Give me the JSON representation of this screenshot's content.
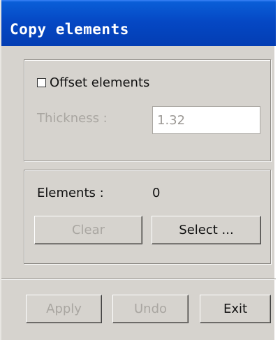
{
  "window": {
    "title": "Copy elements"
  },
  "offset_group": {
    "checkbox_label": "Offset elements",
    "checkbox_checked": false,
    "thickness_label": "Thickness :",
    "thickness_value": "1.32"
  },
  "elements_group": {
    "label": "Elements :",
    "count": "0",
    "clear_label": "Clear",
    "select_label": "Select ..."
  },
  "footer": {
    "apply_label": "Apply",
    "undo_label": "Undo",
    "exit_label": "Exit"
  }
}
